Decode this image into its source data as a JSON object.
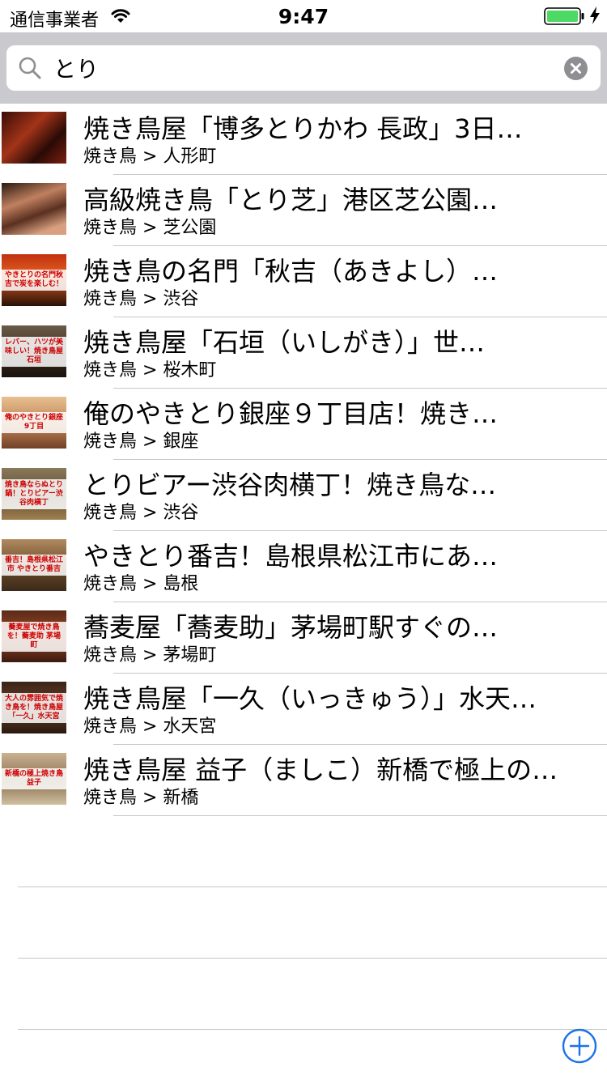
{
  "status_bar": {
    "carrier": "通信事業者",
    "time": "9:47"
  },
  "search": {
    "query": "とり",
    "icon": "search-icon",
    "clear_icon": "clear-icon"
  },
  "results": [
    {
      "title": "焼き鳥屋「博多とりかわ 長政」3日…",
      "subtitle": "焼き鳥 > 人形町",
      "thumb_caption": "",
      "thumb_color": "#5a1a10"
    },
    {
      "title": "高級焼き鳥「とり芝」港区芝公園…",
      "subtitle": "焼き鳥 > 芝公園",
      "thumb_caption": "",
      "thumb_color": "#6b3a26"
    },
    {
      "title": "焼き鳥の名門「秋吉（あきよし）…",
      "subtitle": "焼き鳥 > 渋谷",
      "thumb_caption": "やきとりの名門秋吉で炭を楽しむ！",
      "thumb_color": "#8a2a12"
    },
    {
      "title": "焼き鳥屋「石垣（いしがき）」世…",
      "subtitle": "焼き鳥 > 桜木町",
      "thumb_caption": "レバー、ハツが美味しい！焼き鳥屋 石垣",
      "thumb_color": "#4a3a30"
    },
    {
      "title": "俺のやきとり銀座９丁目店！焼き…",
      "subtitle": "焼き鳥 > 銀座",
      "thumb_caption": "俺のやきとり銀座9丁目",
      "thumb_color": "#a06040"
    },
    {
      "title": "とりビアー渋谷肉横丁！焼き鳥な…",
      "subtitle": "焼き鳥 > 渋谷",
      "thumb_caption": "焼き鳥ならぬとり鍋！とりビアー渋谷肉横丁",
      "thumb_color": "#6a5a40"
    },
    {
      "title": "やきとり番吉！島根県松江市にあ…",
      "subtitle": "焼き鳥 > 島根",
      "thumb_caption": "番吉！島根県松江市 やきとり番吉",
      "thumb_color": "#5a4028"
    },
    {
      "title": "蕎麦屋「蕎麦助」茅場町駅すぐの…",
      "subtitle": "焼き鳥 > 茅場町",
      "thumb_caption": "蕎麦屋で焼き鳥を！蕎麦助 茅場町",
      "thumb_color": "#7a3a22"
    },
    {
      "title": "焼き鳥屋「一久（いっきゅう）」水天…",
      "subtitle": "焼き鳥 > 水天宮",
      "thumb_caption": "大人の雰囲気で焼き鳥を！焼き鳥屋「一久」水天宮",
      "thumb_color": "#4a3020"
    },
    {
      "title": "焼き鳥屋 益子（ましこ）新橋で極上の…",
      "subtitle": "焼き鳥 > 新橋",
      "thumb_caption": "新橋の極上焼き鳥益子",
      "thumb_color": "#8a7050"
    }
  ],
  "empty_rows": 3,
  "add_button": {
    "icon": "plus-circle-icon",
    "color": "#1a73e8"
  },
  "colors": {
    "search_bar_bg": "#c9c9ce",
    "separator": "#c8c7cc",
    "battery_green": "#4cd964"
  }
}
